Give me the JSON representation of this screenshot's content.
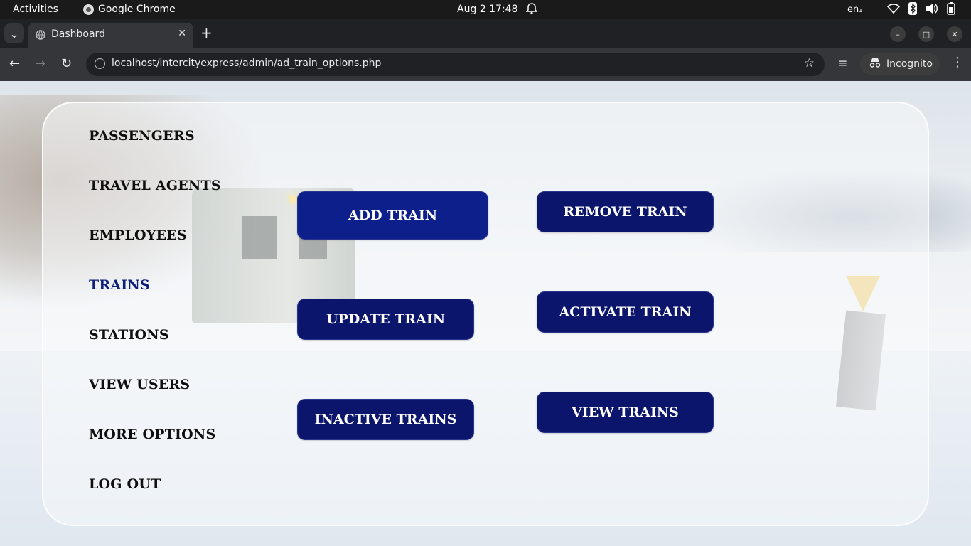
{
  "system_bar": {
    "activities": "Activities",
    "app_name": "Google Chrome",
    "clock": "Aug 2  17:48",
    "language": "en₁"
  },
  "browser": {
    "tab_title": "Dashboard",
    "url": "localhost/intercityexpress/admin/ad_train_options.php",
    "profile_label": "Incognito"
  },
  "sidebar": {
    "items": [
      {
        "label": "PASSENGERS"
      },
      {
        "label": "TRAVEL AGENTS"
      },
      {
        "label": "EMPLOYEES"
      },
      {
        "label": "TRAINS",
        "active": true
      },
      {
        "label": "STATIONS"
      },
      {
        "label": "VIEW USERS"
      },
      {
        "label": "MORE OPTIONS"
      },
      {
        "label": "LOG OUT"
      }
    ]
  },
  "actions": {
    "add_train": "ADD TRAIN",
    "remove_train": "REMOVE TRAIN",
    "update_train": "UPDATE TRAIN",
    "activate_train": "ACTIVATE TRAIN",
    "inactive_trains": "INACTIVE TRAINS",
    "view_trains": "VIEW TRAINS"
  },
  "colors": {
    "button_bg": "#0b156b",
    "active_nav": "#0c1f7a"
  }
}
